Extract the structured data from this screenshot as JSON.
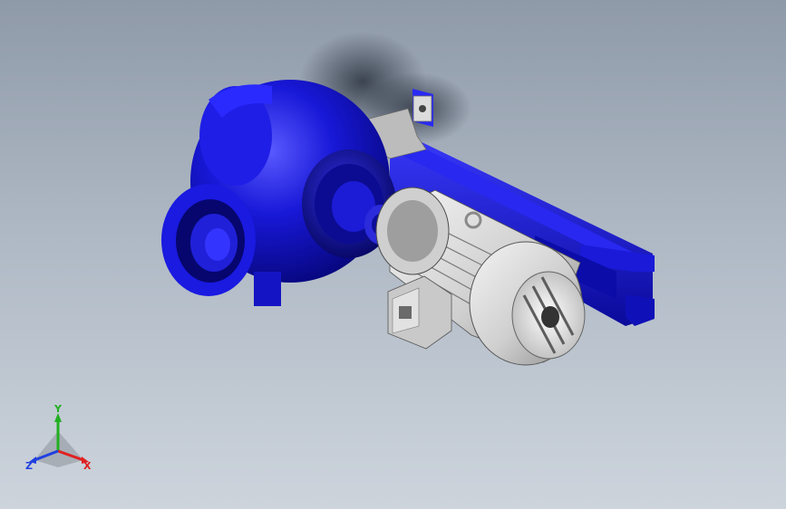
{
  "viewport": {
    "background_top": "#8f9aa9",
    "background_bottom": "#cdd4dc"
  },
  "model": {
    "pump_color": "#1414d0",
    "motor_color": "#d8d8d8",
    "bracket_color": "#b8b8b8"
  },
  "triad": {
    "x_label": "X",
    "y_label": "Y",
    "z_label": "Z",
    "x_color": "#e02020",
    "y_color": "#20b020",
    "z_color": "#2040e0"
  }
}
